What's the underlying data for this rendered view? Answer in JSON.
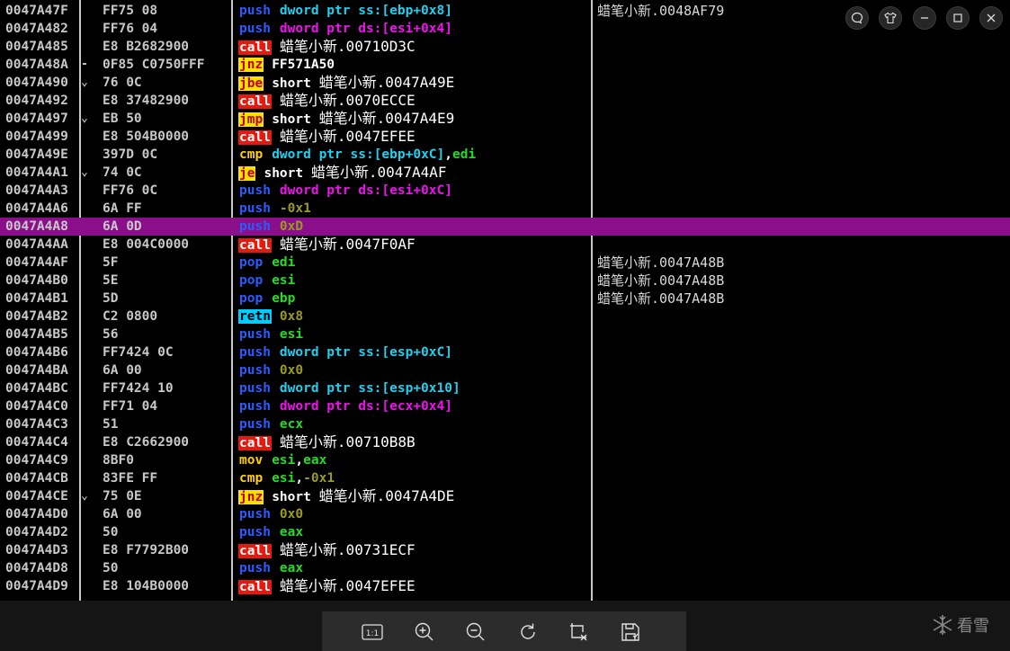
{
  "disassembly": {
    "rows": [
      {
        "addr": "0047A47F",
        "jm": "",
        "hex": "FF75 08",
        "mn": "push",
        "mk": "push",
        "ops": [
          {
            "t": "dword ptr ss:[ebp+0x8]",
            "k": "ss"
          }
        ],
        "cmt": "蜡笔小新.0048AF79"
      },
      {
        "addr": "0047A482",
        "jm": "",
        "hex": "FF76 04",
        "mn": "push",
        "mk": "push",
        "ops": [
          {
            "t": "dword ptr ds:[esi+0x4]",
            "k": "mem"
          }
        ],
        "cmt": ""
      },
      {
        "addr": "0047A485",
        "jm": "",
        "hex": "E8 B2682900",
        "mn": "call",
        "mk": "call",
        "ops": [
          {
            "t": "蜡笔小新.00710D3C",
            "k": "lbl"
          }
        ],
        "cmt": ""
      },
      {
        "addr": "0047A48A",
        "jm": "-",
        "hex": "0F85 C0750FFF",
        "mn": "jnz",
        "mk": "jcc",
        "ops": [
          {
            "t": "FF571A50",
            "k": "tgt"
          }
        ],
        "cmt": ""
      },
      {
        "addr": "0047A490",
        "jm": "⌄",
        "hex": "76 0C",
        "mn": "jbe",
        "mk": "jcc",
        "ops": [
          {
            "t": "short ",
            "k": "tgt"
          },
          {
            "t": "蜡笔小新.0047A49E",
            "k": "lbl"
          }
        ],
        "cmt": ""
      },
      {
        "addr": "0047A492",
        "jm": "",
        "hex": "E8 37482900",
        "mn": "call",
        "mk": "call",
        "ops": [
          {
            "t": "蜡笔小新.0070ECCE",
            "k": "lbl"
          }
        ],
        "cmt": ""
      },
      {
        "addr": "0047A497",
        "jm": "⌄",
        "hex": "EB 50",
        "mn": "jmp",
        "mk": "jmp",
        "ops": [
          {
            "t": "short ",
            "k": "tgt"
          },
          {
            "t": "蜡笔小新.0047A4E9",
            "k": "lbl"
          }
        ],
        "cmt": ""
      },
      {
        "addr": "0047A499",
        "jm": "",
        "hex": "E8 504B0000",
        "mn": "call",
        "mk": "call",
        "ops": [
          {
            "t": "蜡笔小新.0047EFEE",
            "k": "lbl"
          }
        ],
        "cmt": ""
      },
      {
        "addr": "0047A49E",
        "jm": "",
        "hex": "397D 0C",
        "mn": "cmp",
        "mk": "cmp",
        "ops": [
          {
            "t": "dword ptr ss:[ebp+0xC]",
            "k": "ss"
          },
          {
            "t": ",",
            "k": "tgt"
          },
          {
            "t": "edi",
            "k": "reg"
          }
        ],
        "cmt": ""
      },
      {
        "addr": "0047A4A1",
        "jm": "⌄",
        "hex": "74 0C",
        "mn": "je",
        "mk": "jcc",
        "ops": [
          {
            "t": "short ",
            "k": "tgt"
          },
          {
            "t": "蜡笔小新.0047A4AF",
            "k": "lbl"
          }
        ],
        "cmt": ""
      },
      {
        "addr": "0047A4A3",
        "jm": "",
        "hex": "FF76 0C",
        "mn": "push",
        "mk": "push",
        "ops": [
          {
            "t": "dword ptr ds:[esi+0xC]",
            "k": "mem"
          }
        ],
        "cmt": ""
      },
      {
        "addr": "0047A4A6",
        "jm": "",
        "hex": "6A FF",
        "mn": "push",
        "mk": "push",
        "ops": [
          {
            "t": "-0x1",
            "k": "imm"
          }
        ],
        "cmt": ""
      },
      {
        "addr": "0047A4A8",
        "jm": "",
        "hex": "6A 0D",
        "mn": "push",
        "mk": "push",
        "ops": [
          {
            "t": "0xD",
            "k": "imm"
          }
        ],
        "cmt": "",
        "sel": true
      },
      {
        "addr": "0047A4AA",
        "jm": "",
        "hex": "E8 004C0000",
        "mn": "call",
        "mk": "call",
        "ops": [
          {
            "t": "蜡笔小新.0047F0AF",
            "k": "lbl"
          }
        ],
        "cmt": ""
      },
      {
        "addr": "0047A4AF",
        "jm": "",
        "hex": "5F",
        "mn": "pop",
        "mk": "pop",
        "ops": [
          {
            "t": "edi",
            "k": "reg"
          }
        ],
        "cmt": "蜡笔小新.0047A48B"
      },
      {
        "addr": "0047A4B0",
        "jm": "",
        "hex": "5E",
        "mn": "pop",
        "mk": "pop",
        "ops": [
          {
            "t": "esi",
            "k": "reg"
          }
        ],
        "cmt": "蜡笔小新.0047A48B"
      },
      {
        "addr": "0047A4B1",
        "jm": "",
        "hex": "5D",
        "mn": "pop",
        "mk": "pop",
        "ops": [
          {
            "t": "ebp",
            "k": "reg"
          }
        ],
        "cmt": "蜡笔小新.0047A48B"
      },
      {
        "addr": "0047A4B2",
        "jm": "",
        "hex": "C2 0800",
        "mn": "retn",
        "mk": "retn",
        "ops": [
          {
            "t": "0x8",
            "k": "imm"
          }
        ],
        "cmt": ""
      },
      {
        "addr": "0047A4B5",
        "jm": "",
        "hex": "56",
        "mn": "push",
        "mk": "push",
        "ops": [
          {
            "t": "esi",
            "k": "reg"
          }
        ],
        "cmt": ""
      },
      {
        "addr": "0047A4B6",
        "jm": "",
        "hex": "FF7424 0C",
        "mn": "push",
        "mk": "push",
        "ops": [
          {
            "t": "dword ptr ss:[esp+0xC]",
            "k": "ss"
          }
        ],
        "cmt": ""
      },
      {
        "addr": "0047A4BA",
        "jm": "",
        "hex": "6A 00",
        "mn": "push",
        "mk": "push",
        "ops": [
          {
            "t": "0x0",
            "k": "imm"
          }
        ],
        "cmt": ""
      },
      {
        "addr": "0047A4BC",
        "jm": "",
        "hex": "FF7424 10",
        "mn": "push",
        "mk": "push",
        "ops": [
          {
            "t": "dword ptr ss:[esp+0x10]",
            "k": "ss"
          }
        ],
        "cmt": ""
      },
      {
        "addr": "0047A4C0",
        "jm": "",
        "hex": "FF71 04",
        "mn": "push",
        "mk": "push",
        "ops": [
          {
            "t": "dword ptr ds:[ecx+0x4]",
            "k": "mem"
          }
        ],
        "cmt": ""
      },
      {
        "addr": "0047A4C3",
        "jm": "",
        "hex": "51",
        "mn": "push",
        "mk": "push",
        "ops": [
          {
            "t": "ecx",
            "k": "reg"
          }
        ],
        "cmt": ""
      },
      {
        "addr": "0047A4C4",
        "jm": "",
        "hex": "E8 C2662900",
        "mn": "call",
        "mk": "call",
        "ops": [
          {
            "t": "蜡笔小新.00710B8B",
            "k": "lbl"
          }
        ],
        "cmt": ""
      },
      {
        "addr": "0047A4C9",
        "jm": "",
        "hex": "8BF0",
        "mn": "mov",
        "mk": "mov",
        "ops": [
          {
            "t": "esi",
            "k": "reg"
          },
          {
            "t": ",",
            "k": "tgt"
          },
          {
            "t": "eax",
            "k": "reg"
          }
        ],
        "cmt": ""
      },
      {
        "addr": "0047A4CB",
        "jm": "",
        "hex": "83FE FF",
        "mn": "cmp",
        "mk": "cmp",
        "ops": [
          {
            "t": "esi",
            "k": "reg"
          },
          {
            "t": ",",
            "k": "tgt"
          },
          {
            "t": "-0x1",
            "k": "imm"
          }
        ],
        "cmt": ""
      },
      {
        "addr": "0047A4CE",
        "jm": "⌄",
        "hex": "75 0E",
        "mn": "jnz",
        "mk": "jcc",
        "ops": [
          {
            "t": "short ",
            "k": "tgt"
          },
          {
            "t": "蜡笔小新.0047A4DE",
            "k": "lbl"
          }
        ],
        "cmt": ""
      },
      {
        "addr": "0047A4D0",
        "jm": "",
        "hex": "6A 00",
        "mn": "push",
        "mk": "push",
        "ops": [
          {
            "t": "0x0",
            "k": "imm"
          }
        ],
        "cmt": ""
      },
      {
        "addr": "0047A4D2",
        "jm": "",
        "hex": "50",
        "mn": "push",
        "mk": "push",
        "ops": [
          {
            "t": "eax",
            "k": "reg"
          }
        ],
        "cmt": ""
      },
      {
        "addr": "0047A4D3",
        "jm": "",
        "hex": "E8 F7792B00",
        "mn": "call",
        "mk": "call",
        "ops": [
          {
            "t": "蜡笔小新.00731ECF",
            "k": "lbl"
          }
        ],
        "cmt": ""
      },
      {
        "addr": "0047A4D8",
        "jm": "",
        "hex": "50",
        "mn": "push",
        "mk": "push",
        "ops": [
          {
            "t": "eax",
            "k": "reg"
          }
        ],
        "cmt": ""
      },
      {
        "addr": "0047A4D9",
        "jm": "",
        "hex": "E8 104B0000",
        "mn": "call",
        "mk": "call",
        "ops": [
          {
            "t": "蜡笔小新.0047EFEE",
            "k": "lbl"
          }
        ],
        "cmt": ""
      }
    ]
  },
  "window_controls": [
    {
      "name": "chat-icon"
    },
    {
      "name": "tshirt-icon"
    },
    {
      "name": "minimize-icon"
    },
    {
      "name": "maximize-icon"
    },
    {
      "name": "close-icon"
    }
  ],
  "toolbar": {
    "actual_size_label": "1:1",
    "buttons": [
      "actual-size-icon",
      "zoom-in-icon",
      "zoom-out-icon",
      "rotate-icon",
      "crop-icon",
      "save-icon"
    ]
  },
  "watermark": {
    "text": "看雪"
  },
  "colors": {
    "selected_row": "#8b0f8b",
    "call_bg": "#e8180c",
    "jump_bg": "#ffe100",
    "retn_bg": "#00ccff",
    "push_pop": "#2a5cff",
    "memory": "#f010f0",
    "stack_segment": "#1fd0f0",
    "register": "#22dd22",
    "immediate": "#9a9a20"
  }
}
